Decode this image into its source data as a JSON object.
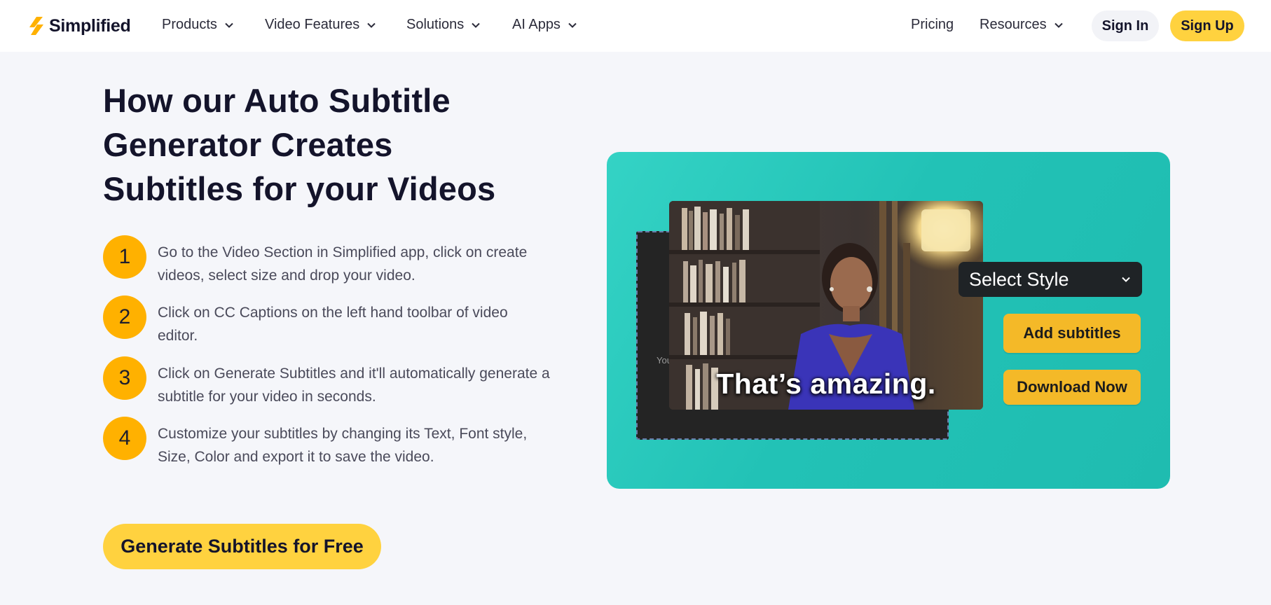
{
  "nav": {
    "logo": "Simplified",
    "items": [
      {
        "label": "Products",
        "icon": "chevron-down-icon"
      },
      {
        "label": "Video Features",
        "icon": "chevron-down-icon"
      },
      {
        "label": "Solutions",
        "icon": "chevron-down-icon"
      },
      {
        "label": "AI Apps",
        "icon": "chevron-down-icon"
      }
    ],
    "pricing": "Pricing",
    "resources": "Resources",
    "sign_in": "Sign In",
    "sign_up": "Sign Up"
  },
  "main": {
    "headline": "How our Auto Subtitle Generator Creates Subtitles for your Videos",
    "steps": [
      {
        "num": "1",
        "text": "Go to the Video Section in Simplified app, click on create videos, select size and drop your video."
      },
      {
        "num": "2",
        "text": "Click on CC Captions on the left hand toolbar of video editor."
      },
      {
        "num": "3",
        "text": "Click on Generate Subtitles and it'll automatically generate a subtitle for your video in seconds."
      },
      {
        "num": "4",
        "text": "Customize your subtitles by changing its Text, Font style, Size, Color and export it to save the video."
      }
    ],
    "cta": "Generate Subtitles for Free"
  },
  "illustration": {
    "panel_label": "You",
    "subtitle": "That’s amazing.",
    "select_style": "Select Style",
    "add_subtitles": "Add subtitles",
    "download_now": "Download Now"
  },
  "colors": {
    "accent_yellow": "#ffd23f",
    "step_orange": "#ffb100",
    "card_teal": "#22c2b6",
    "button_gold": "#f4b928"
  }
}
